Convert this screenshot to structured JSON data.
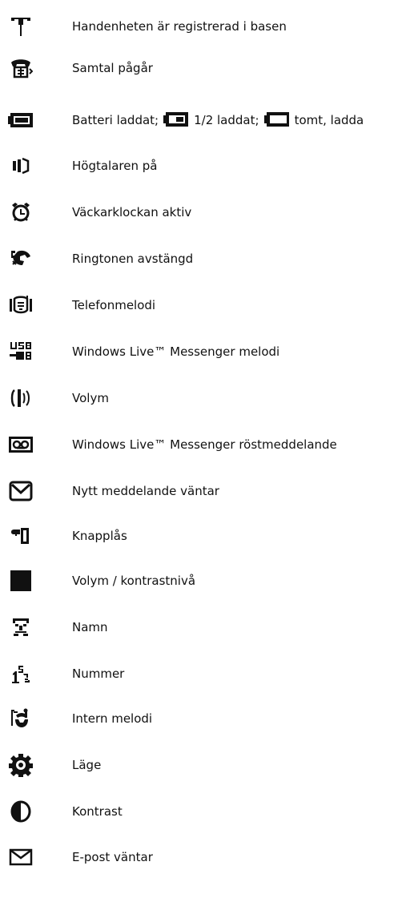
{
  "items": [
    {
      "icon": "antenna-icon",
      "label": "Handenheten är registrerad i basen"
    },
    {
      "icon": "phone-call-icon",
      "label": "Samtal pågår"
    },
    {
      "icon": "battery-full-icon",
      "label": "Batteri laddat;",
      "extra": [
        {
          "icon": "battery-half-icon",
          "text": "1/2 laddat;"
        },
        {
          "icon": "battery-empty-icon",
          "text": "tomt, ladda"
        }
      ]
    },
    {
      "icon": "speaker-icon",
      "label": "Högtalaren på"
    },
    {
      "icon": "alarm-clock-icon",
      "label": "Väckarklockan aktiv"
    },
    {
      "icon": "ringer-off-icon",
      "label": "Ringtonen avstängd"
    },
    {
      "icon": "phone-melody-icon",
      "label": "Telefonmelodi"
    },
    {
      "icon": "usb-icon",
      "label": "Windows Live™ Messenger melodi"
    },
    {
      "icon": "volume-icon",
      "label": "Volym"
    },
    {
      "icon": "voicemail-icon",
      "label": "Windows Live™ Messenger röstmeddelande"
    },
    {
      "icon": "envelope-icon",
      "label": "Nytt meddelande väntar"
    },
    {
      "icon": "keylock-icon",
      "label": "Knapplås"
    },
    {
      "icon": "level-block-icon",
      "label": "Volym / kontrastnivå"
    },
    {
      "icon": "name-icon",
      "label": "Namn"
    },
    {
      "icon": "number-icon",
      "label": "Nummer"
    },
    {
      "icon": "internal-melody-icon",
      "label": "Intern melodi"
    },
    {
      "icon": "mode-gear-icon",
      "label": "Läge"
    },
    {
      "icon": "contrast-icon",
      "label": "Kontrast"
    },
    {
      "icon": "email-icon",
      "label": "E-post väntar"
    }
  ]
}
